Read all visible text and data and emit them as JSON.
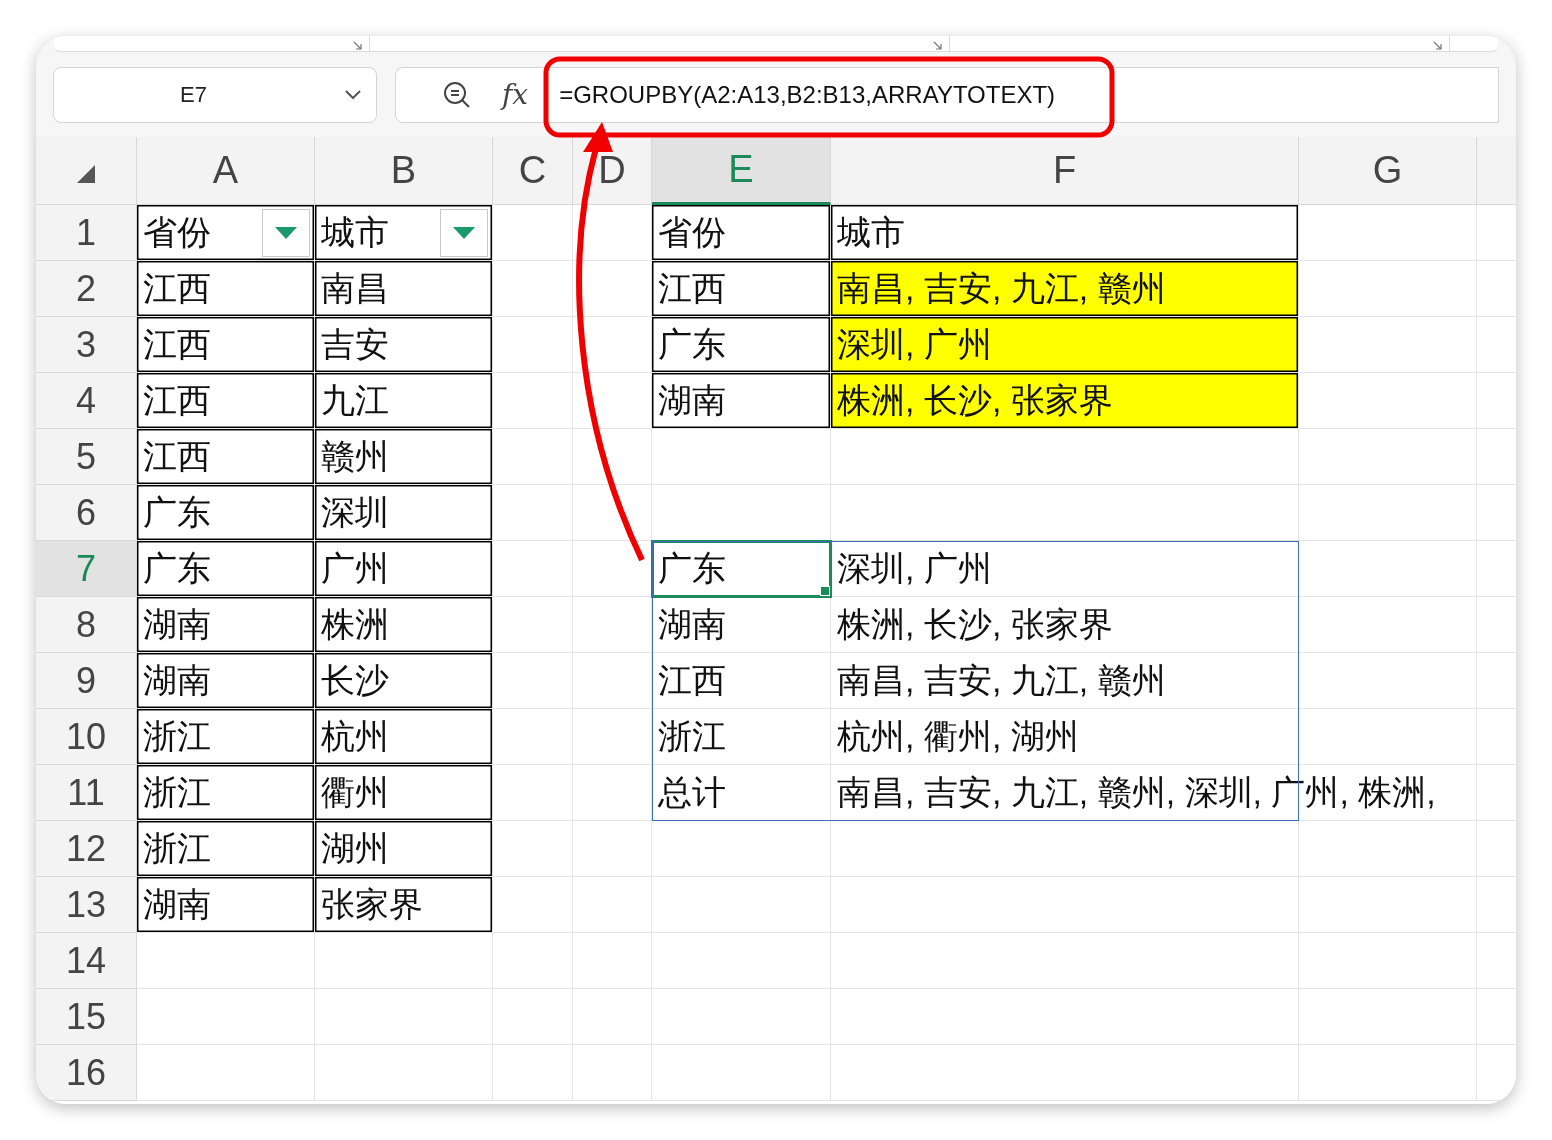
{
  "name_box": {
    "value": "E7"
  },
  "formula_bar": {
    "fx_label": "fx",
    "formula": "=GROUPBY(A2:A13,B2:B13,ARRAYTOTEXT)"
  },
  "columns": [
    {
      "label": "A",
      "selected": false
    },
    {
      "label": "B",
      "selected": false
    },
    {
      "label": "C",
      "selected": false
    },
    {
      "label": "D",
      "selected": false
    },
    {
      "label": "E",
      "selected": true
    },
    {
      "label": "F",
      "selected": false
    },
    {
      "label": "G",
      "selected": false
    }
  ],
  "rows": [
    {
      "label": "1",
      "selected": false
    },
    {
      "label": "2",
      "selected": false
    },
    {
      "label": "3",
      "selected": false
    },
    {
      "label": "4",
      "selected": false
    },
    {
      "label": "5",
      "selected": false
    },
    {
      "label": "6",
      "selected": false
    },
    {
      "label": "7",
      "selected": true
    },
    {
      "label": "8",
      "selected": false
    },
    {
      "label": "9",
      "selected": false
    },
    {
      "label": "10",
      "selected": false
    },
    {
      "label": "11",
      "selected": false
    },
    {
      "label": "12",
      "selected": false
    },
    {
      "label": "13",
      "selected": false
    },
    {
      "label": "14",
      "selected": false
    },
    {
      "label": "15",
      "selected": false
    },
    {
      "label": "16",
      "selected": false
    }
  ],
  "source_table": {
    "header": [
      {
        "text": "省份",
        "filter": true
      },
      {
        "text": "城市",
        "filter": true
      }
    ],
    "rows": [
      [
        "江西",
        "南昌"
      ],
      [
        "江西",
        "吉安"
      ],
      [
        "江西",
        "九江"
      ],
      [
        "江西",
        "赣州"
      ],
      [
        "广东",
        "深圳"
      ],
      [
        "广东",
        "广州"
      ],
      [
        "湖南",
        "株洲"
      ],
      [
        "湖南",
        "长沙"
      ],
      [
        "浙江",
        "杭州"
      ],
      [
        "浙江",
        "衢州"
      ],
      [
        "浙江",
        "湖州"
      ],
      [
        "湖南",
        "张家界"
      ]
    ]
  },
  "summary_table": {
    "header": [
      "省份",
      "城市"
    ],
    "rows": [
      {
        "province": "江西",
        "cities": "南昌, 吉安, 九江, 赣州",
        "highlighted": true
      },
      {
        "province": "广东",
        "cities": "深圳, 广州",
        "highlighted": true
      },
      {
        "province": "湖南",
        "cities": "株洲, 长沙, 张家界",
        "highlighted": true
      }
    ]
  },
  "groupby_result": {
    "rows": [
      {
        "province": "广东",
        "cities": "深圳, 广州",
        "selected": true
      },
      {
        "province": "湖南",
        "cities": "株洲, 长沙, 张家界",
        "selected": false
      },
      {
        "province": "江西",
        "cities": "南昌, 吉安, 九江, 赣州",
        "selected": false
      },
      {
        "province": "浙江",
        "cities": "杭州, 衢州, 湖州",
        "selected": false
      },
      {
        "province": "总计",
        "cities": "南昌, 吉安, 九江, 赣州, 深圳, 广州, 株洲,",
        "selected": false
      }
    ]
  }
}
